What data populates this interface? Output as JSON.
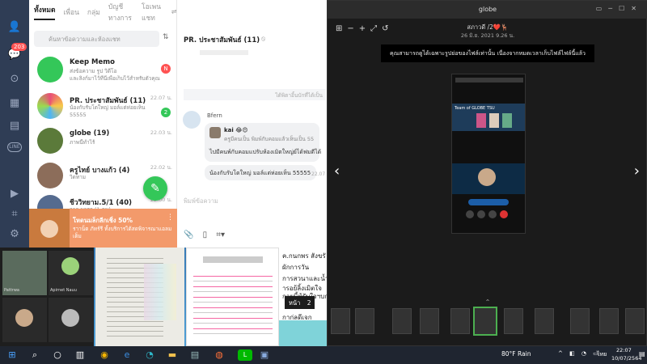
{
  "line": {
    "tabs": [
      "ทั้งหมด",
      "เพื่อน",
      "กลุ่ม",
      "บัญชีทางการ",
      "โอเพนแชท"
    ],
    "search_placeholder": "ค้นหาข้อความและห้องแชท",
    "rail_badge": "203",
    "rail_line_label": "LINE",
    "chats": [
      {
        "name": "Keep Memo",
        "sub1": "ส่งข้อความ รูป วิดีโอ",
        "sub2": "และลิงก์มาไว้ที่นี่เพื่อเก็บไว้สำหรับตัวคุณ",
        "time": "",
        "badge": "N",
        "badge_color": "#ff5252",
        "avatar_color": "#34c759"
      },
      {
        "name": "PR. ประชาสัมพันธ์ (11)",
        "sub1": "น้องกับรับโตใหญ่ มอล์แต่ห่อยเห็น",
        "sub2": "55555",
        "time": "22.07 น.",
        "badge": "2",
        "badge_color": "#34c759",
        "avatar_color": "#e9b44c"
      },
      {
        "name": "globe (19)",
        "sub1": "ภาพนี้ทำไร้",
        "sub2": "",
        "time": "22.03 น.",
        "badge": "",
        "badge_color": "",
        "avatar_color": "#5b7a3a"
      },
      {
        "name": "ครูไทย์ บางแก้ว (4)",
        "sub1": "วิดทาม",
        "sub2": "",
        "time": "22.02 น.",
        "badge": "",
        "badge_color": "",
        "avatar_color": "#8c6d5a"
      },
      {
        "name": "ชีววิทยาม.5/1 (40)",
        "sub1": "จาก มารถ (1 คน)",
        "sub2": "",
        "time": "22.00 น.",
        "badge": "",
        "badge_color": "",
        "avatar_color": "#556b8f"
      }
    ],
    "promo": {
      "title": "โหดนมล็กลีกเชิ่ง 50%",
      "sub": "ราาน็ต ภัทร์รี ทั้งบริการได้สดพิจารณาแอลมเต็ม"
    },
    "conversation": {
      "title": "PR. ประชาสัมพันธ์ (11)",
      "notice": "ได้พิตาอิ้นบักที่ได้เป็น",
      "sender": "Bfern",
      "reply_name": "kai 😂😍",
      "reply_quote": "ครูมีคนเป็น พิมพ์กับคอมแล้วเห็นเป็น 55",
      "reply_text": "ไปมีคนพ์กับคอมแปรับห้องเมิตใหญ่ย์ได้ฟมดีได้",
      "message2": "น้องกับรับโตใหญ่ มอล์แต่ห่อยเห็น 55555",
      "time": "22.07",
      "composer_placeholder": "พิมพ์ข้อความ"
    }
  },
  "viewer": {
    "window_title": "globe",
    "sender": "สภาวดี /2❤️🦌",
    "date": "26 มิ.ย. 2021 9.26 น.",
    "notice": "คุณสามารถดูได้เฉพาะรูปย่อของไฟล์เท่านั้น เนื่องจากหมดเวลาเก็บไฟล์ไฟล์นี้แล้ว",
    "photo_banner": "Team of GLOBE TSU"
  },
  "thumbs": {
    "meet_names": [
      "Pattrwa",
      "Apirnet Nauu",
      "",
      ""
    ],
    "text_lines": [
      "ค.กนกพร  สังขรั",
      "ผักการวัน",
      "การสวนาและน้ำแ",
      "ารอย้ลิ้งเมิตใจ",
      "กายนี้ห้รับใจฯบก",
      "กาก่ลดีเจก"
    ],
    "pager_label": "หน้า",
    "pager_page": "2"
  },
  "taskbar": {
    "weather": "80°F Rain",
    "lang": "ไทย",
    "time": "22:07",
    "date": "10/07/2564"
  },
  "colors": {
    "line_green": "#34c759",
    "rail_bg": "#2f3d55",
    "viewer_bg": "#1b1b1b",
    "taskbar_bg": "#1f2530"
  }
}
